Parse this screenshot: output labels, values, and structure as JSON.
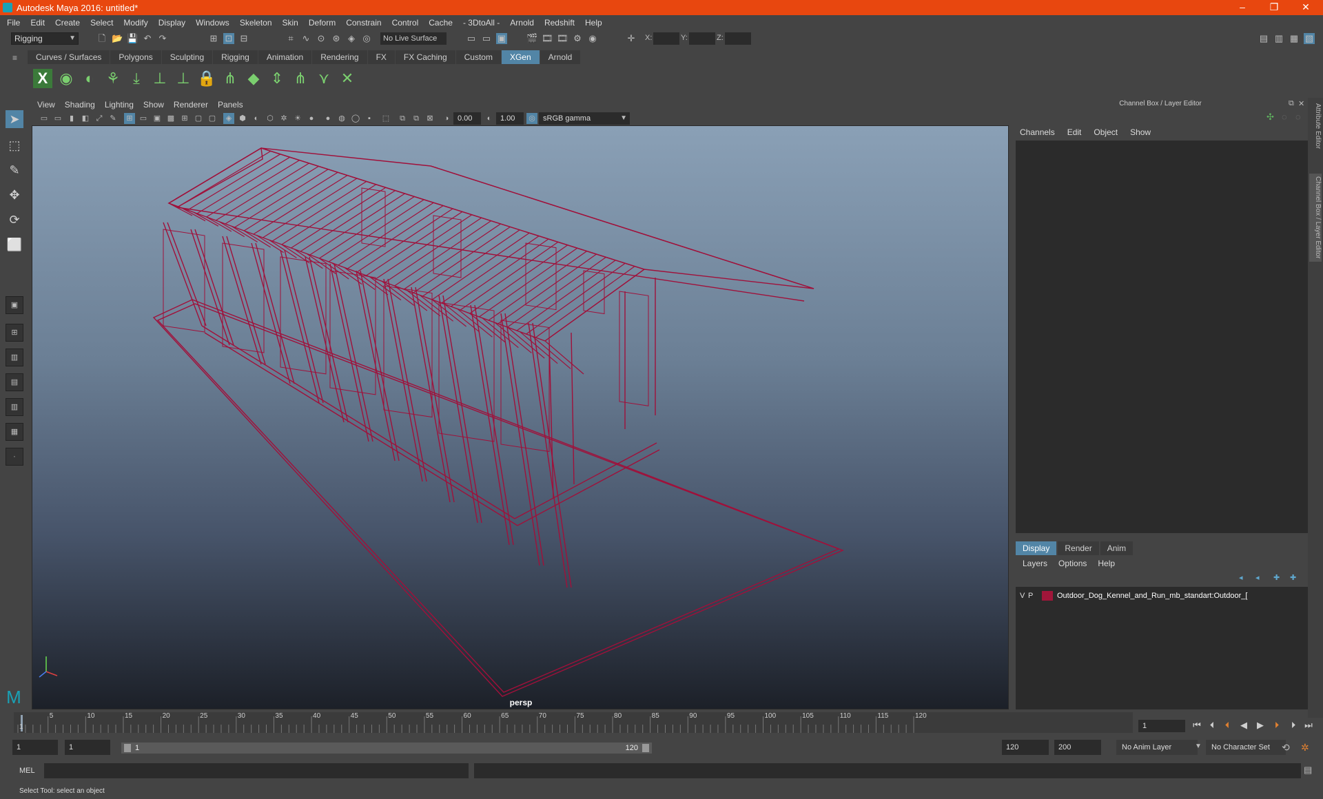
{
  "window": {
    "title": "Autodesk Maya 2016: untitled*"
  },
  "menus": [
    "File",
    "Edit",
    "Create",
    "Select",
    "Modify",
    "Display",
    "Windows",
    "Skeleton",
    "Skin",
    "Deform",
    "Constrain",
    "Control",
    "Cache",
    "- 3DtoAll -",
    "Arnold",
    "Redshift",
    "Help"
  ],
  "status": {
    "mode": "Rigging",
    "live_surface": "No Live Surface",
    "x_label": "X:",
    "y_label": "Y:",
    "z_label": "Z:"
  },
  "shelf_tabs": [
    "Curves / Surfaces",
    "Polygons",
    "Sculpting",
    "Rigging",
    "Animation",
    "Rendering",
    "FX",
    "FX Caching",
    "Custom",
    "XGen",
    "Arnold"
  ],
  "shelf_active": "XGen",
  "viewport": {
    "menus": [
      "View",
      "Shading",
      "Lighting",
      "Show",
      "Renderer",
      "Panels"
    ],
    "exposure": "0.00",
    "gamma": "1.00",
    "color_space": "sRGB gamma",
    "camera": "persp",
    "wire_color": "#a0103a"
  },
  "channel_box": {
    "title": "Channel Box / Layer Editor",
    "menus": [
      "Channels",
      "Edit",
      "Object",
      "Show"
    ]
  },
  "layer_editor": {
    "tabs": [
      "Display",
      "Render",
      "Anim"
    ],
    "active_tab": "Display",
    "menus": [
      "Layers",
      "Options",
      "Help"
    ],
    "layer": {
      "v": "V",
      "p": "P",
      "name": "Outdoor_Dog_Kennel_and_Run_mb_standart:Outdoor_[",
      "color": "#a0163a"
    }
  },
  "side_tabs": [
    "Attribute Editor",
    "Channel Box / Layer Editor"
  ],
  "timeline": {
    "ticks": [
      "1",
      "5",
      "10",
      "15",
      "20",
      "25",
      "30",
      "35",
      "40",
      "45",
      "50",
      "55",
      "60",
      "65",
      "70",
      "75",
      "80",
      "85",
      "90",
      "95",
      "100",
      "105",
      "110",
      "115",
      "120"
    ],
    "current_frame": "1"
  },
  "range": {
    "start": "1",
    "playback_start": "1",
    "slider_start": "1",
    "slider_end": "120",
    "playback_end": "120",
    "end": "200",
    "anim_layer": "No Anim Layer",
    "character_set": "No Character Set"
  },
  "command": {
    "label": "MEL"
  },
  "help_line": "Select Tool: select an object"
}
